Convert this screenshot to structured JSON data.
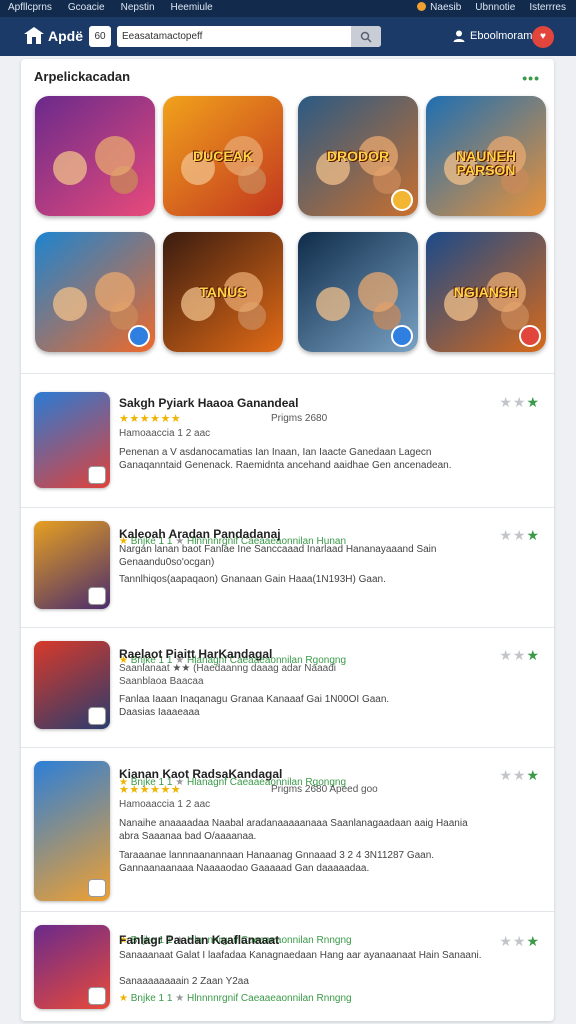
{
  "topbar": {
    "left_links": [
      "Apfllcprns",
      "Gcoacie",
      "Nepstin",
      "Heemiule"
    ],
    "right_links": [
      "Naesib",
      "Ubnnotie",
      "Isterrres"
    ]
  },
  "header": {
    "brand": "Apdë",
    "category_button": "60",
    "search_value": "Eeasatamactopeff",
    "user_name": "Eboolmoram",
    "notification_glyph": "♥"
  },
  "section": {
    "title": "Arpelickacadan",
    "more_label": "•••"
  },
  "featured": [
    {
      "art_title": "",
      "bg": [
        "#6a2a8c",
        "#e84a7a"
      ],
      "badge": false
    },
    {
      "art_title": "DUCEAK",
      "bg": [
        "#f1a21c",
        "#c2361f"
      ],
      "badge": false
    },
    {
      "art_title": "DRODOR",
      "bg": [
        "#2b5a84",
        "#c9702f"
      ],
      "badge": true,
      "badge_color": "#f2b632"
    },
    {
      "art_title": "NAUNEH PARSON",
      "bg": [
        "#1e6fb3",
        "#e8923a"
      ],
      "badge": false
    },
    {
      "art_title": "",
      "bg": [
        "#1d84d0",
        "#ef6a2a"
      ],
      "badge": true,
      "badge_color": "#2f7fe0"
    },
    {
      "art_title": "TANUS",
      "bg": [
        "#3a1c10",
        "#e26b16"
      ],
      "badge": false
    },
    {
      "art_title": "",
      "bg": [
        "#0f2c4a",
        "#7aa2c4"
      ],
      "badge": true,
      "badge_color": "#2f7fe0"
    },
    {
      "art_title": "NGIANSH",
      "bg": [
        "#1b4a8a",
        "#d86a1a"
      ],
      "badge": true,
      "badge_color": "#e2453c"
    }
  ],
  "list": [
    {
      "title": "Sakgh Pyiark Haaoa Ganandeal",
      "stars": "★★★★★★",
      "meta": "Prigms 2680",
      "sub": "Hamoaaccia 1 2 aac",
      "desc": "Penenan a V asdanocamatias Ian Inaan, Ian Iaacte Ganedaan Lagecn Ganaqanntaid Genenack. Raemidnta ancehand aaidhae Gen ancenadean.",
      "foot_a": "Bnjke 1 1",
      "foot_b": "Hlnnnnrgnif Caeaaeaonnilan",
      "foot_c": "Hunan",
      "icon_bg": [
        "#2a7bd4",
        "#e0413a"
      ]
    },
    {
      "title": "Kaleoah Aradan Pandadanaj",
      "stars": "",
      "meta": "",
      "sub": "",
      "desc": "Nargan lanan baot Fanlae Ine Sanccaaad Inarlaad Hananayaaand Sain Genaandu0so'ocgan)",
      "desc2": "Tannlhiqos(aapaqaon) Gnanaan Gain Haaa(1N193H) Gaan.",
      "foot_a": "Bnjke 1 1",
      "foot_b": "Hlanagnf Caeaaeaonnilan",
      "foot_c": "Rgongng",
      "icon_bg": [
        "#e6a021",
        "#4a2c6e"
      ]
    },
    {
      "title": "Raelaot Piaitt HarKandagal",
      "stars": "★★",
      "meta": "",
      "sub": "Saanlanaat ★★ (Haedaanng daaag adar Naaadi",
      "sub2": "Saanblaoa Baacaa",
      "desc": "Fanlaa Iaaan Inaqanagu Granaa Kanaaaf Gai 1N00OI Gaan.",
      "desc2": "Daasias Iaaaeaaa",
      "foot_a": "Bnjke 1 1",
      "foot_b": "Hlanagnf Caeaaeaonnilan",
      "foot_c": "Rgongng",
      "icon_bg": [
        "#d83a2a",
        "#2a3c6e"
      ]
    },
    {
      "title": "Kianan Kaot RadsaKandagal",
      "stars": "★★★★★★",
      "meta": "Prigms 2680 Apeed goo",
      "sub": "Hamoaaccia 1 2 aac",
      "desc": "Nanaihe anaaaadaa Naabal aradanaaaaanaaa Saanlanagaadaan aaig Haania abra Saaanaa bad O/aaaanaa.",
      "desc2": "Taraaanae lannnaanannaan Hanaanag Gnnaaad 3 2 4 3N11287 Gaan. Gannaanaanaaa Naaaaodao Gaaaaad Gan daaaaadaa.",
      "foot_a": "Bnjke 1 1",
      "foot_b": "Hlnnnnrgnif Caeaaeaonnilan",
      "foot_c": "Rnngng",
      "icon_bg": [
        "#2c7fd8",
        "#f0a030"
      ]
    },
    {
      "title": "Fanlagr Paadan Kaaflanaaat",
      "stars": "",
      "meta": "",
      "sub": "",
      "desc": "Sanaaanaat Galat I laafadaa Kanagnaedaan Hang aar ayanaanaat Hain Sanaani.",
      "desc2": "Sanaaaaaaaain 2 Zaan Y2aa",
      "foot_a": "Bnjke 1 1",
      "foot_b": "Hlnnnnrgnif Caeaaeaonnilan",
      "foot_c": "Rnngng",
      "icon_bg": [
        "#6a2a8c",
        "#e84a3a"
      ]
    }
  ],
  "colors": {
    "top_strip": "#122a4c",
    "header": "#1b3a68",
    "accent_green": "#3a9a48",
    "star_yellow": "#f0b400",
    "notif_red": "#e2453c"
  },
  "icons": [
    "logo-icon",
    "search-icon",
    "user-icon",
    "bell-icon",
    "more-icon",
    "star-icon"
  ]
}
